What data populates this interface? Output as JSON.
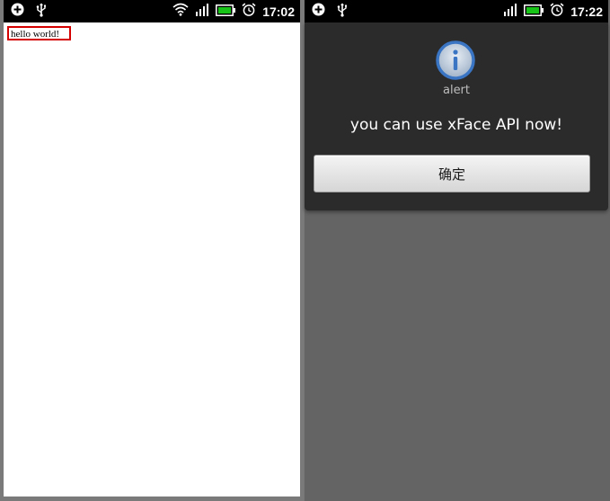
{
  "left_phone": {
    "status_bar": {
      "left_icons": [
        "add-circle-icon",
        "usb-icon"
      ],
      "right_icons": [
        "wifi-icon",
        "signal-icon",
        "battery-icon",
        "alarm-icon"
      ],
      "time": "17:02"
    },
    "content": {
      "text": "hello world!",
      "highlight_color": "#d40000"
    }
  },
  "right_phone": {
    "status_bar": {
      "left_icons": [
        "add-circle-icon",
        "usb-icon"
      ],
      "right_icons": [
        "signal-icon",
        "battery-icon",
        "alarm-icon"
      ],
      "time": "17:22"
    },
    "dialog": {
      "icon": "info-icon",
      "title": "alert",
      "message": "you can use xFace API now!",
      "button_label": "确定"
    }
  },
  "colors": {
    "battery": "#18c418",
    "dialog_bg": "#2b2b2b",
    "info_icon": "#3a75c4"
  }
}
